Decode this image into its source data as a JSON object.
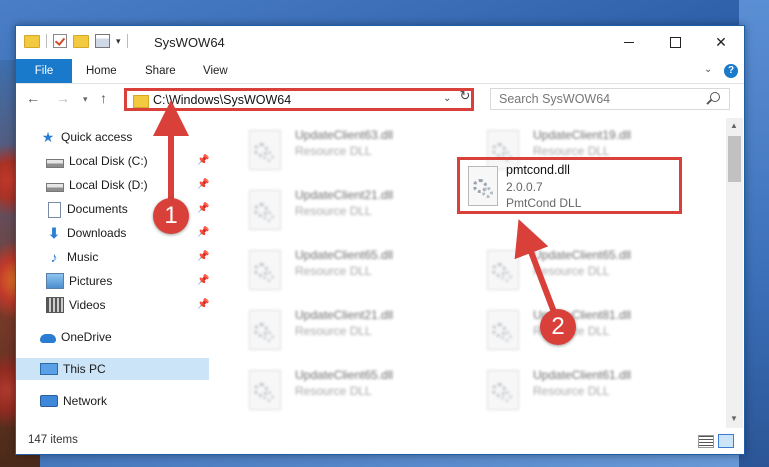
{
  "window": {
    "title": "SysWOW64"
  },
  "ribbon": {
    "tabs": [
      "File",
      "Home",
      "Share",
      "View"
    ]
  },
  "address": {
    "path": "C:\\Windows\\SysWOW64",
    "search_placeholder": "Search SysWOW64"
  },
  "nav": {
    "items": [
      {
        "label": "Quick access",
        "icon": "star-icon"
      },
      {
        "label": "Local Disk (C:)",
        "icon": "drive-icon",
        "pinned": true
      },
      {
        "label": "Local Disk (D:)",
        "icon": "drive-icon",
        "pinned": true
      },
      {
        "label": "Documents",
        "icon": "documents-icon",
        "pinned": true
      },
      {
        "label": "Downloads",
        "icon": "downloads-icon",
        "pinned": true
      },
      {
        "label": "Music",
        "icon": "music-icon",
        "pinned": true
      },
      {
        "label": "Pictures",
        "icon": "pictures-icon",
        "pinned": true
      },
      {
        "label": "Videos",
        "icon": "videos-icon",
        "pinned": true
      },
      {
        "label": "OneDrive",
        "icon": "onedrive-icon"
      },
      {
        "label": "This PC",
        "icon": "this-pc-icon",
        "selected": true
      },
      {
        "label": "Network",
        "icon": "network-icon"
      }
    ]
  },
  "files": [
    {
      "name": "UpdateClient63.dll",
      "type": "Resource DLL"
    },
    {
      "name": "UpdateClient19.dll",
      "type": "Resource DLL"
    },
    {
      "name": "UpdateClient21.dll",
      "type": "Resource DLL"
    },
    {
      "name": "UpdateClient65.dll",
      "type": "Resource DLL"
    },
    {
      "name": "UpdateClient65.dll",
      "type": "Resource DLL"
    },
    {
      "name": "UpdateClient21.dll",
      "type": "Resource DLL"
    },
    {
      "name": "UpdateClient81.dll",
      "type": "Resource DLL"
    },
    {
      "name": "UpdateClient65.dll",
      "type": "Resource DLL"
    },
    {
      "name": "UpdateClient61.dll",
      "type": "Resource DLL"
    }
  ],
  "highlighted_file": {
    "name": "pmtcond.dll",
    "version": "2.0.0.7",
    "type": "PmtCond DLL"
  },
  "status": {
    "items_count": "147 items"
  },
  "annotations": {
    "step1": "1",
    "step2": "2"
  },
  "colors": {
    "accent": "#1979ca",
    "highlight": "#d9403a",
    "selected_bg": "#cce4f7"
  }
}
